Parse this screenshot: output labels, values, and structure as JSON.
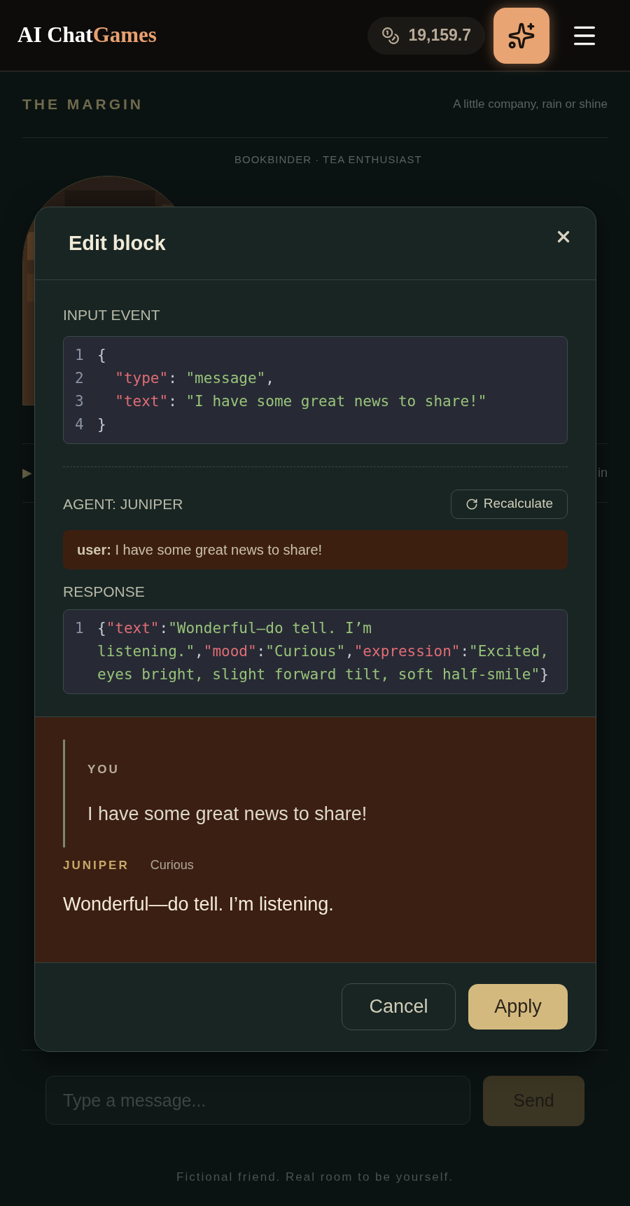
{
  "header": {
    "logo": {
      "main": "AI Chat",
      "accent": "Games"
    },
    "balance": "19,159.7"
  },
  "page": {
    "title": "THE MARGIN",
    "tagline": "A little company, rain or shine",
    "character_role": "BOOKBINDER · TEA ENTHUSIAST",
    "row": {
      "marker": "▶",
      "trailing": "in"
    },
    "composer": {
      "placeholder": "Type a message...",
      "send": "Send"
    },
    "footer": "Fictional friend. Real room to be yourself."
  },
  "dialog": {
    "title": "Edit block",
    "input_event": {
      "label": "INPUT EVENT",
      "lines": [
        {
          "n": "1",
          "code": "{"
        },
        {
          "n": "2",
          "code": "  \"type\": \"message\","
        },
        {
          "n": "3",
          "code": "  \"text\": \"I have some great news to share!\""
        },
        {
          "n": "4",
          "code": "}"
        }
      ]
    },
    "agent": {
      "label": "AGENT: JUNIPER",
      "recalculate": "Recalculate",
      "prompt": "**user:** I have some great news to share!"
    },
    "response": {
      "label": "RESPONSE",
      "lines": [
        {
          "n": "1",
          "code": "{\"text\":\"Wonderful—do tell. I’m listening.\",\"mood\":\"Curious\",\"expression\":\"Excited, eyes bright, slight forward tilt, soft half-smile\"}"
        }
      ]
    },
    "preview": {
      "user_label": "YOU",
      "user_text": "I have some great news to share!",
      "agent_name": "JUNIPER",
      "mood": "Curious",
      "agent_text": "Wonderful—do tell. I’m listening."
    },
    "buttons": {
      "cancel": "Cancel",
      "apply": "Apply"
    }
  }
}
